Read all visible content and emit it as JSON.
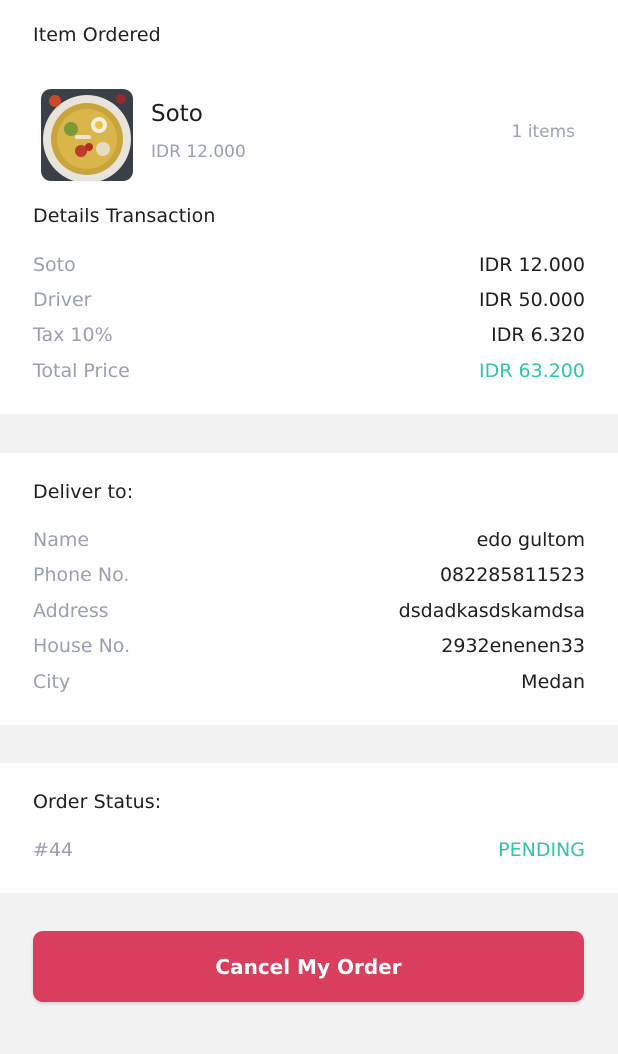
{
  "items_section": {
    "title": "Item Ordered",
    "item": {
      "name": "Soto",
      "price": "IDR 12.000",
      "quantity": "1 items",
      "image_icon": "food-photo"
    }
  },
  "transaction": {
    "title": "Details Transaction",
    "rows": [
      {
        "label": "Soto",
        "value": "IDR 12.000"
      },
      {
        "label": "Driver",
        "value": "IDR 50.000"
      },
      {
        "label": "Tax 10%",
        "value": "IDR 6.320"
      },
      {
        "label": "Total Price",
        "value": "IDR 63.200"
      }
    ]
  },
  "delivery": {
    "title": "Deliver to:",
    "rows": [
      {
        "label": "Name",
        "value": "edo gultom"
      },
      {
        "label": "Phone No.",
        "value": "082285811523"
      },
      {
        "label": "Address",
        "value": "dsdadkasdskamdsa"
      },
      {
        "label": "House No.",
        "value": "2932enenen33"
      },
      {
        "label": "City",
        "value": "Medan"
      }
    ]
  },
  "status": {
    "title": "Order Status:",
    "order_id": "#44",
    "state": "PENDING"
  },
  "actions": {
    "cancel_label": "Cancel My Order"
  },
  "colors": {
    "accent": "#2fc7a4",
    "cancel": "#d93f5c",
    "muted": "#9aa0ad",
    "divider": "#f2f2f2"
  }
}
